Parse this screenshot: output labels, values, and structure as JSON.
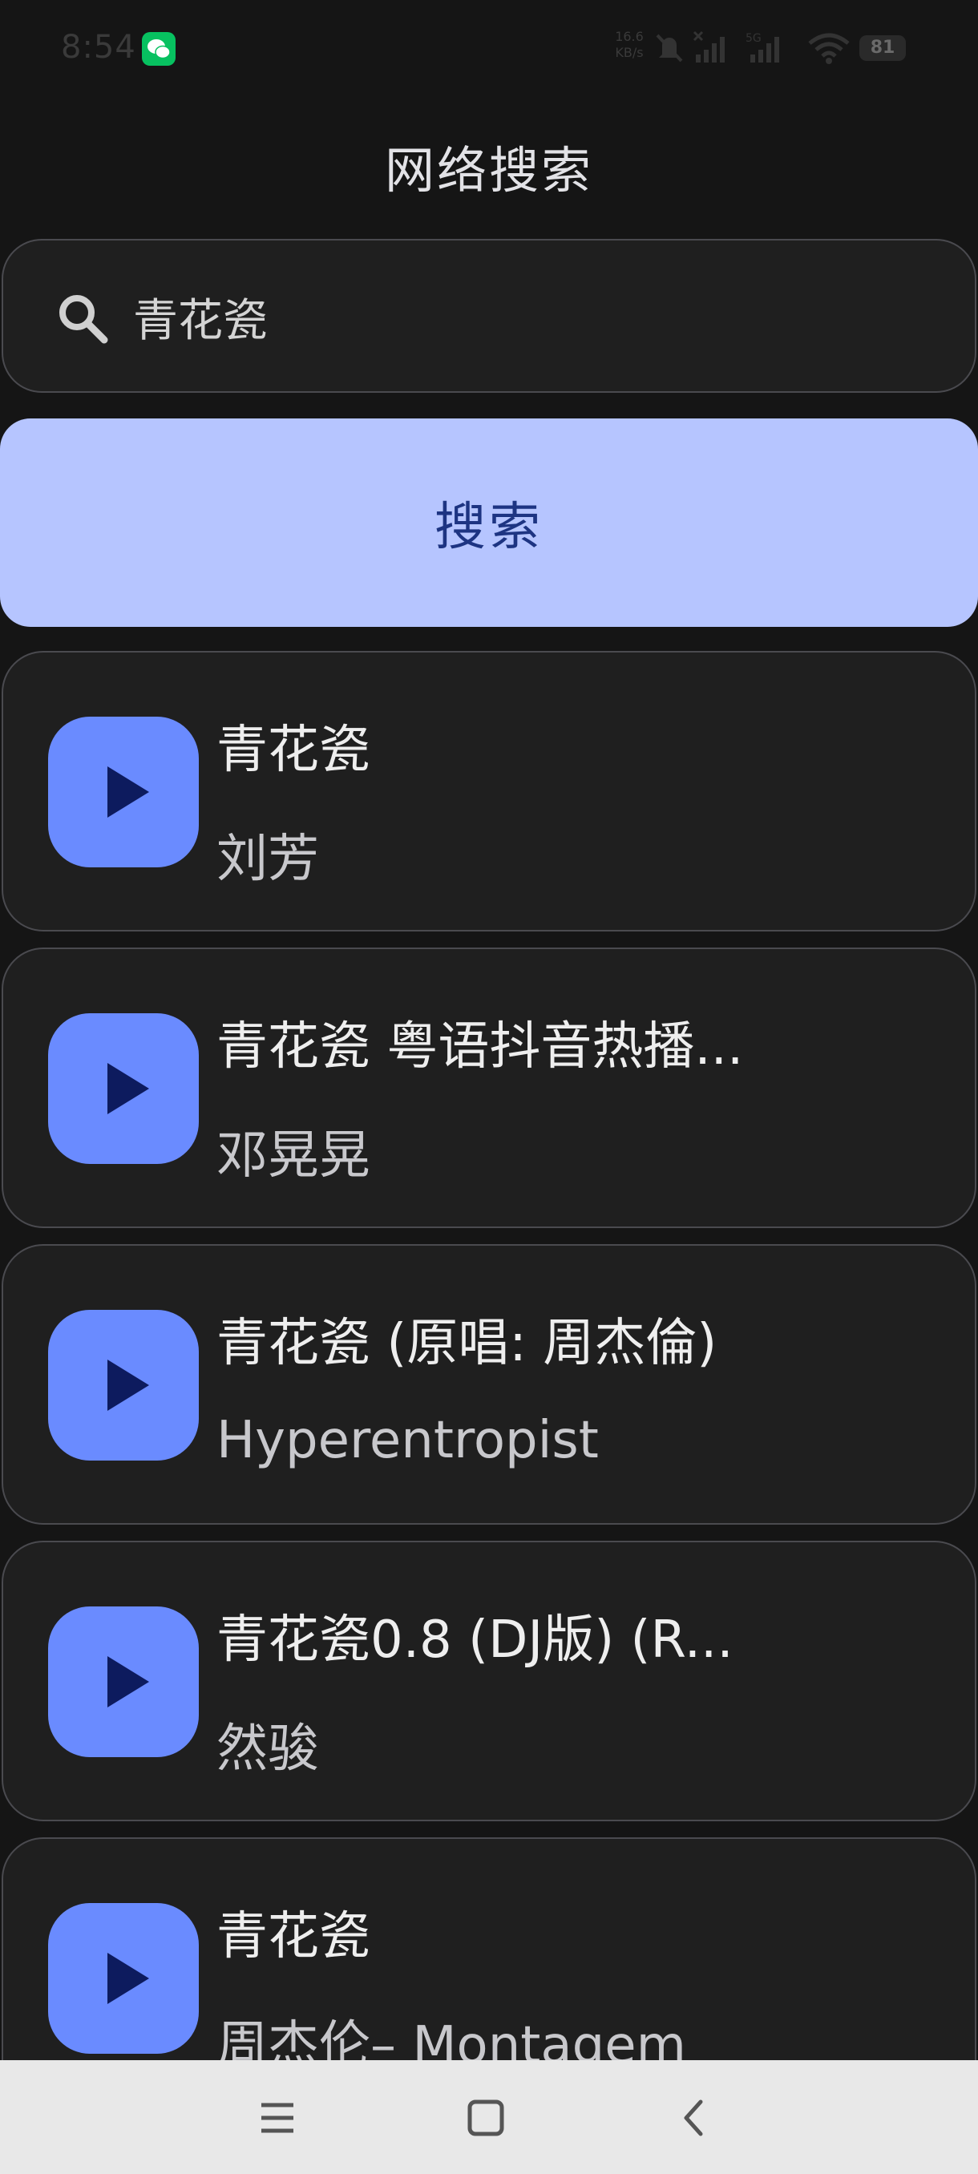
{
  "status_bar": {
    "time": "8:54",
    "net_speed_value": "16.6",
    "net_speed_unit": "KB/s",
    "battery": "81"
  },
  "page": {
    "title": "网络搜索"
  },
  "search": {
    "query": "青花瓷"
  },
  "search_button": {
    "label": "搜索"
  },
  "results": [
    {
      "title": "青花瓷",
      "artist": "刘芳"
    },
    {
      "title": "青花瓷 粤语抖音热播...",
      "artist": "邓晃晃"
    },
    {
      "title": "青花瓷 (原唱: 周杰倫)",
      "artist": "Hyperentropist"
    },
    {
      "title": "青花瓷0.8 (DJ版) (R...",
      "artist": "然骏"
    },
    {
      "title": "青花瓷",
      "artist": "周杰伦– Montagem"
    }
  ],
  "colors": {
    "background": "#151515",
    "card": "#1f1f1f",
    "card_border": "#4a4a4f",
    "accent": "#6a8bff",
    "button_bg": "#b6c5ff",
    "button_text": "#1d3482",
    "nav_bar": "#e8e8e8"
  },
  "icons": {
    "status": [
      "wechat-icon",
      "mute-icon",
      "no-signal-icon",
      "signal-icon",
      "wifi-icon",
      "battery-icon"
    ],
    "search": "search-icon",
    "result": "play-icon",
    "navigation": [
      "menu-icon",
      "home-icon",
      "back-icon"
    ]
  }
}
